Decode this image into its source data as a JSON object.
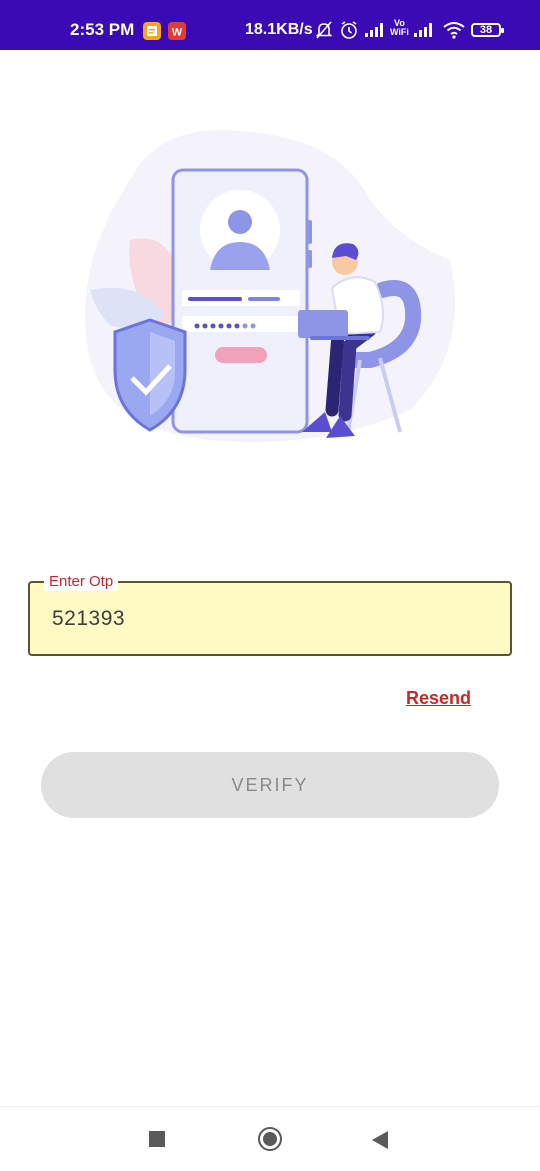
{
  "status_bar": {
    "time": "2:53 PM",
    "network_speed": "18.1KB/s",
    "battery_level": "38",
    "bg_color": "#3a0bb5",
    "icons": [
      "notes-app-icon",
      "wps-app-icon",
      "mute-icon",
      "alarm-icon",
      "signal-icon",
      "vowifi-icon",
      "signal-icon",
      "wifi-icon",
      "battery-icon"
    ],
    "vowifi_label_top": "Vo",
    "vowifi_label_bottom": "WiFi"
  },
  "illustration": {
    "description_icon": "otp-verification-illustration"
  },
  "otp_field": {
    "label": "Enter Otp",
    "value": "521393",
    "bg_color": "#fff9c4",
    "label_color": "#c62828"
  },
  "resend": {
    "label": "Resend"
  },
  "verify_button": {
    "label": "VERIFY",
    "disabled": true
  },
  "nav_bar": {
    "recents_icon": "recents-square-icon",
    "home_icon": "home-circle-icon",
    "back_icon": "back-triangle-icon"
  }
}
